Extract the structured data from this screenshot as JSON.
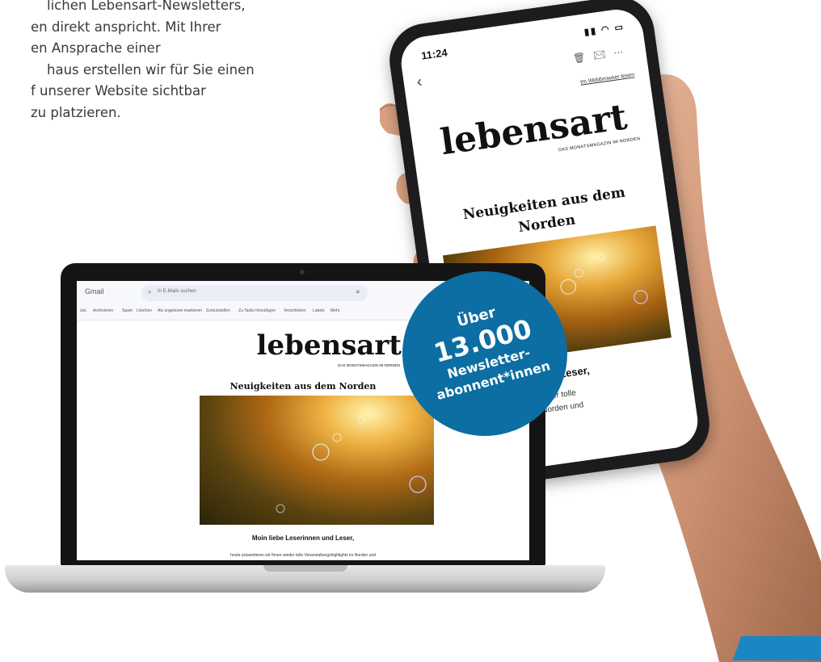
{
  "intro": {
    "line1": "lichen Lebensart-Newsletters,",
    "line2": "en direkt anspricht. Mit Ihrer",
    "line3": "en Ansprache einer",
    "line4": "haus erstellen wir für Sie einen",
    "line5": "f unserer Website sichtbar",
    "line6": "zu platzieren."
  },
  "phone": {
    "time": "11:24",
    "web_link": "Im Webbrowser lesen",
    "logo": "lebensart",
    "logo_sub": "DAS MONATSMAGAZIN IM NORDEN",
    "headline_line1": "Neuigkeiten aus dem",
    "headline_line2": "Norden",
    "greeting": "ebe Leserinnen und Leser,",
    "body_line1": "äsentieren wir Ihnen wieder tolle",
    "body_line2": "staltungshighlights im Norden und"
  },
  "laptop": {
    "gmail_label": "Gmail",
    "search_placeholder": "In E-Mails suchen",
    "actions": [
      "ück",
      "Archivieren",
      "Spam",
      "Löschen",
      "Als ungelesen markieren",
      "Zurückstellen",
      "Zu Tasks hinzufügen",
      "Verschieben",
      "Labels",
      "Mehr"
    ],
    "logo": "lebensart",
    "logo_sub": "DAS MONATSMAGAZIN IM NORDEN",
    "headline": "Neuigkeiten aus dem Norden",
    "greeting": "Moin liebe Leserinnen und Leser,",
    "body": "heute präsentieren wir Ihnen wieder tolle Veranstaltungshighlights im Norden und"
  },
  "badge": {
    "line1": "Über",
    "line2": "13.000",
    "line3": "Newsletter-",
    "line4": "abonnent*innen"
  },
  "colors": {
    "badge": "#0c6ea2",
    "accent": "#1a86c4",
    "skin": "#c88e6e"
  }
}
